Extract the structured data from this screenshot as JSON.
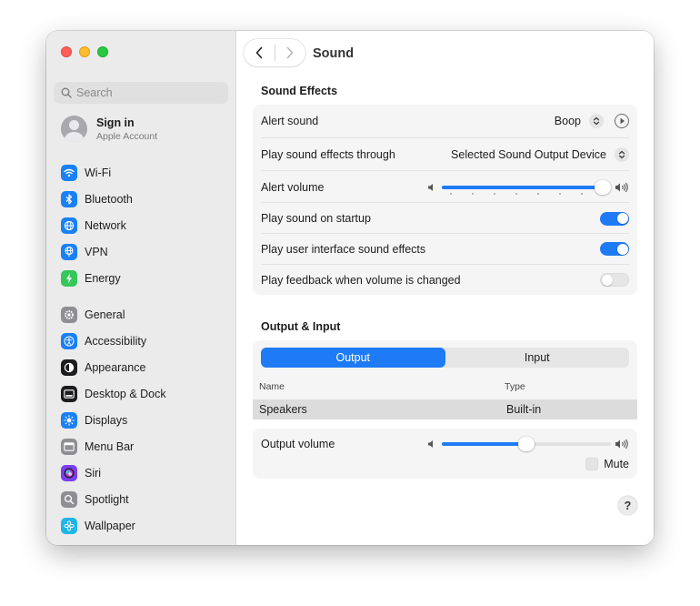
{
  "window": {
    "title": "Sound"
  },
  "sidebar": {
    "search_placeholder": "Search",
    "account": {
      "name": "Sign in",
      "subtitle": "Apple Account"
    },
    "group1": [
      {
        "label": "Wi-Fi",
        "icon": "wifi-icon",
        "color": "#1a80f5"
      },
      {
        "label": "Bluetooth",
        "icon": "bluetooth-icon",
        "color": "#1a80f5"
      },
      {
        "label": "Network",
        "icon": "globe-icon",
        "color": "#1a80f5"
      },
      {
        "label": "VPN",
        "icon": "vpn-globe-icon",
        "color": "#1a80f5"
      },
      {
        "label": "Energy",
        "icon": "bolt-icon",
        "color": "#35c759"
      }
    ],
    "group2": [
      {
        "label": "General",
        "icon": "gear-icon",
        "color": "#8e8e93"
      },
      {
        "label": "Accessibility",
        "icon": "accessibility-icon",
        "color": "#1a80f5"
      },
      {
        "label": "Appearance",
        "icon": "appearance-icon",
        "color": "#1c1c1e"
      },
      {
        "label": "Desktop & Dock",
        "icon": "dock-icon",
        "color": "#1c1c1e"
      },
      {
        "label": "Displays",
        "icon": "sun-icon",
        "color": "#1a80f5"
      },
      {
        "label": "Menu Bar",
        "icon": "menubar-icon",
        "color": "#8e8e93"
      },
      {
        "label": "Siri",
        "icon": "siri-icon",
        "color": "#7a3ff2"
      },
      {
        "label": "Spotlight",
        "icon": "magnifier-icon",
        "color": "#8e8e93"
      },
      {
        "label": "Wallpaper",
        "icon": "flower-icon",
        "color": "#1fb5e8"
      }
    ]
  },
  "sound_effects": {
    "title": "Sound Effects",
    "alert_sound_label": "Alert sound",
    "alert_sound_value": "Boop",
    "play_through_label": "Play sound effects through",
    "play_through_value": "Selected Sound Output Device",
    "alert_volume_label": "Alert volume",
    "alert_volume_level": 1.0,
    "startup_label": "Play sound on startup",
    "startup_on": true,
    "ui_sounds_label": "Play user interface sound effects",
    "ui_sounds_on": true,
    "feedback_label": "Play feedback when volume is changed",
    "feedback_on": false
  },
  "output_input": {
    "title": "Output & Input",
    "tabs": [
      "Output",
      "Input"
    ],
    "active_tab": "Output",
    "columns": [
      "Name",
      "Type"
    ],
    "devices": [
      {
        "name": "Speakers",
        "type": "Built-in"
      }
    ],
    "output_volume_label": "Output volume",
    "output_volume_level": 0.5,
    "mute_label": "Mute",
    "mute_checked": false
  },
  "help_label": "?",
  "accent_color": "#1f7bf5"
}
